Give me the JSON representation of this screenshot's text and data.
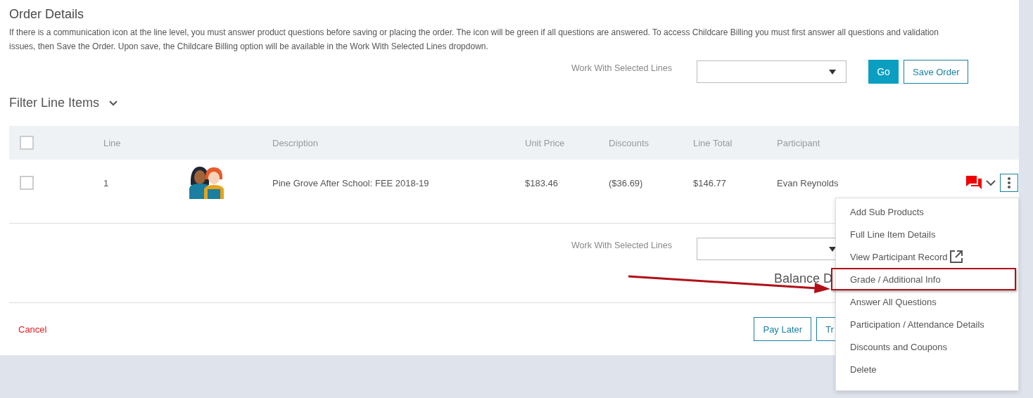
{
  "title": "Order Details",
  "instructions": "If there is a communication icon at the line level, you must answer product questions before saving or placing the order. The icon will be green if all questions are answered. To access Childcare Billing you must first answer all questions and validation issues, then Save the Order. Upon save, the Childcare Billing option will be available in the Work With Selected Lines dropdown.",
  "top_actions": {
    "label": "Work With Selected Lines",
    "go": "Go",
    "save": "Save Order"
  },
  "filter": {
    "label": "Filter Line Items",
    "expanded": false
  },
  "table": {
    "select_all_checked": false,
    "columns": [
      "Line",
      "Description",
      "Unit Price",
      "Discounts",
      "Line Total",
      "Participant"
    ],
    "rows": [
      {
        "checked": false,
        "line": "1",
        "image": {
          "kind": "participants"
        },
        "description": "Pine Grove After School: FEE 2018-19",
        "unit_price": "$183.46",
        "discounts": "($36.69)",
        "line_total": "$146.77",
        "participant": "Evan Reynolds",
        "questions_answered": false
      }
    ]
  },
  "bottom_actions": {
    "label": "Work With Selected Lines",
    "balance": "Balance D"
  },
  "footer": {
    "cancel": "Cancel",
    "buttons": [
      "Pay Later",
      "Tr"
    ]
  },
  "row_menu": {
    "items": [
      {
        "label": "Add Sub Products",
        "external": false,
        "highlighted": false
      },
      {
        "label": "Full Line Item Details",
        "external": false,
        "highlighted": false
      },
      {
        "label": "View Participant Record",
        "external": true,
        "highlighted": false
      },
      {
        "label": "Grade / Additional Info",
        "external": false,
        "highlighted": true
      },
      {
        "label": "Answer All Questions",
        "external": false,
        "highlighted": false
      },
      {
        "label": "Participation / Attendance Details",
        "external": false,
        "highlighted": false
      },
      {
        "label": "Discounts and Coupons",
        "external": false,
        "highlighted": false
      },
      {
        "label": "Delete",
        "external": false,
        "highlighted": false
      }
    ]
  }
}
